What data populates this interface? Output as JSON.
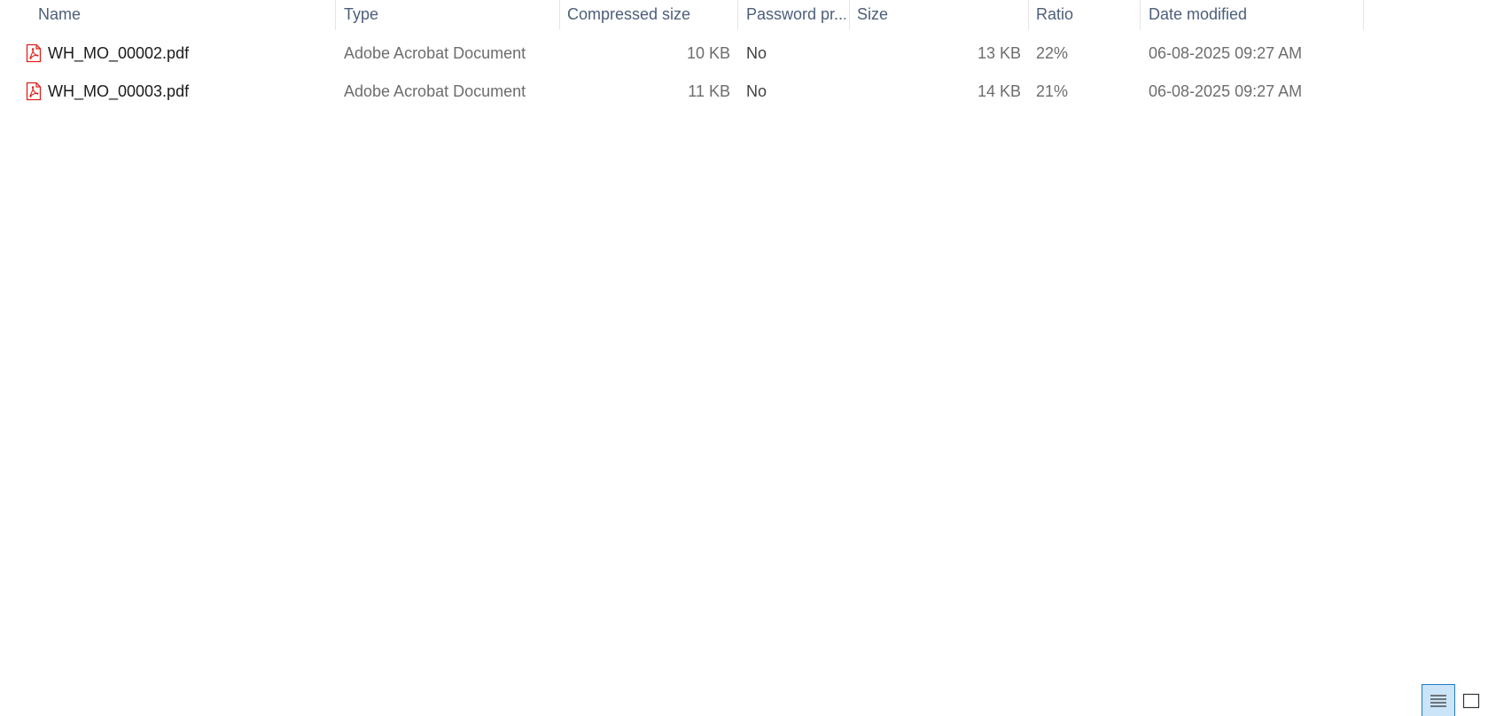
{
  "columns": {
    "name": "Name",
    "type": "Type",
    "compressed": "Compressed size",
    "password": "Password pr...",
    "size": "Size",
    "ratio": "Ratio",
    "date": "Date modified"
  },
  "files": [
    {
      "name": "WH_MO_00002.pdf",
      "type": "Adobe Acrobat Document",
      "compressed": "10 KB",
      "password": "No",
      "size": "13 KB",
      "ratio": "22%",
      "date": "06-08-2025 09:27 AM",
      "icon": "pdf-file-icon"
    },
    {
      "name": "WH_MO_00003.pdf",
      "type": "Adobe Acrobat Document",
      "compressed": "11 KB",
      "password": "No",
      "size": "14 KB",
      "ratio": "21%",
      "date": "06-08-2025 09:27 AM",
      "icon": "pdf-file-icon"
    }
  ],
  "view_buttons": [
    {
      "icon": "details-view-icon",
      "active": true
    },
    {
      "icon": "large-icons-view-icon",
      "active": false
    }
  ],
  "colors": {
    "header_text": "#4d5e7a",
    "pdf_red": "#e0201b",
    "active_view_border": "#1e7bc4",
    "active_view_bg": "#cce4f7"
  }
}
